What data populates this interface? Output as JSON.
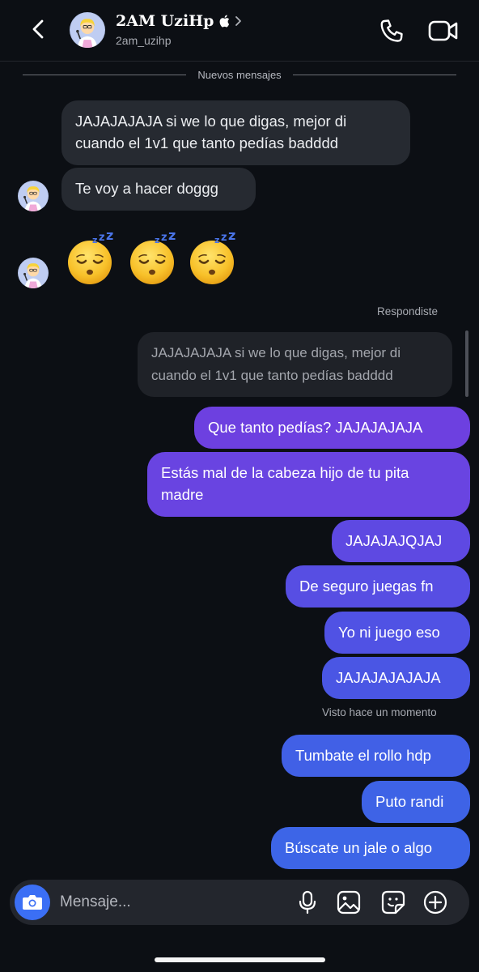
{
  "header": {
    "contact_name": "2AM UziHp",
    "contact_handle": "2am_uzihp"
  },
  "divider_text": "Nuevos mensajes",
  "incoming": [
    {
      "text_line1": "JAJAJAJAJA si we lo que digas, mejor di",
      "text_line2": "cuando el 1v1 que tanto pedías badddd"
    },
    {
      "text": "Te voy a hacer doggg"
    }
  ],
  "emoji_message": {
    "emoji": [
      "sleeping-face",
      "sleeping-face",
      "sleeping-face"
    ]
  },
  "reply": {
    "label": "Respondiste",
    "quoted_line1": "JAJAJAJAJA si we lo que digas, mejor di",
    "quoted_line2": "cuando el 1v1 que tanto pedías badddd"
  },
  "outgoing": [
    {
      "text": "Que tanto pedías? JAJAJAJAJA"
    },
    {
      "text_line1": "Estás mal de la cabeza hijo de tu pita",
      "text_line2": "madre"
    },
    {
      "text": "JAJAJAJQJAJ"
    },
    {
      "text": "De seguro juegas fn"
    },
    {
      "text": "Yo ni juego eso"
    },
    {
      "text": "JAJAJAJAJAJA"
    }
  ],
  "seen_status": "Visto hace un momento",
  "outgoing_after": [
    {
      "text": "Tumbate el rollo hdp"
    },
    {
      "text": "Puto randi"
    },
    {
      "text": "Búscate un jale o algo"
    }
  ],
  "composer": {
    "placeholder": "Mensaje..."
  },
  "colors": {
    "background": "#0c0f14",
    "incoming_bubble": "#262a31",
    "outgoing_purple": "#6f41e0",
    "outgoing_indigo": "#4a55e4",
    "outgoing_blue": "#3e63e6",
    "camera_button": "#3b6ff5"
  }
}
